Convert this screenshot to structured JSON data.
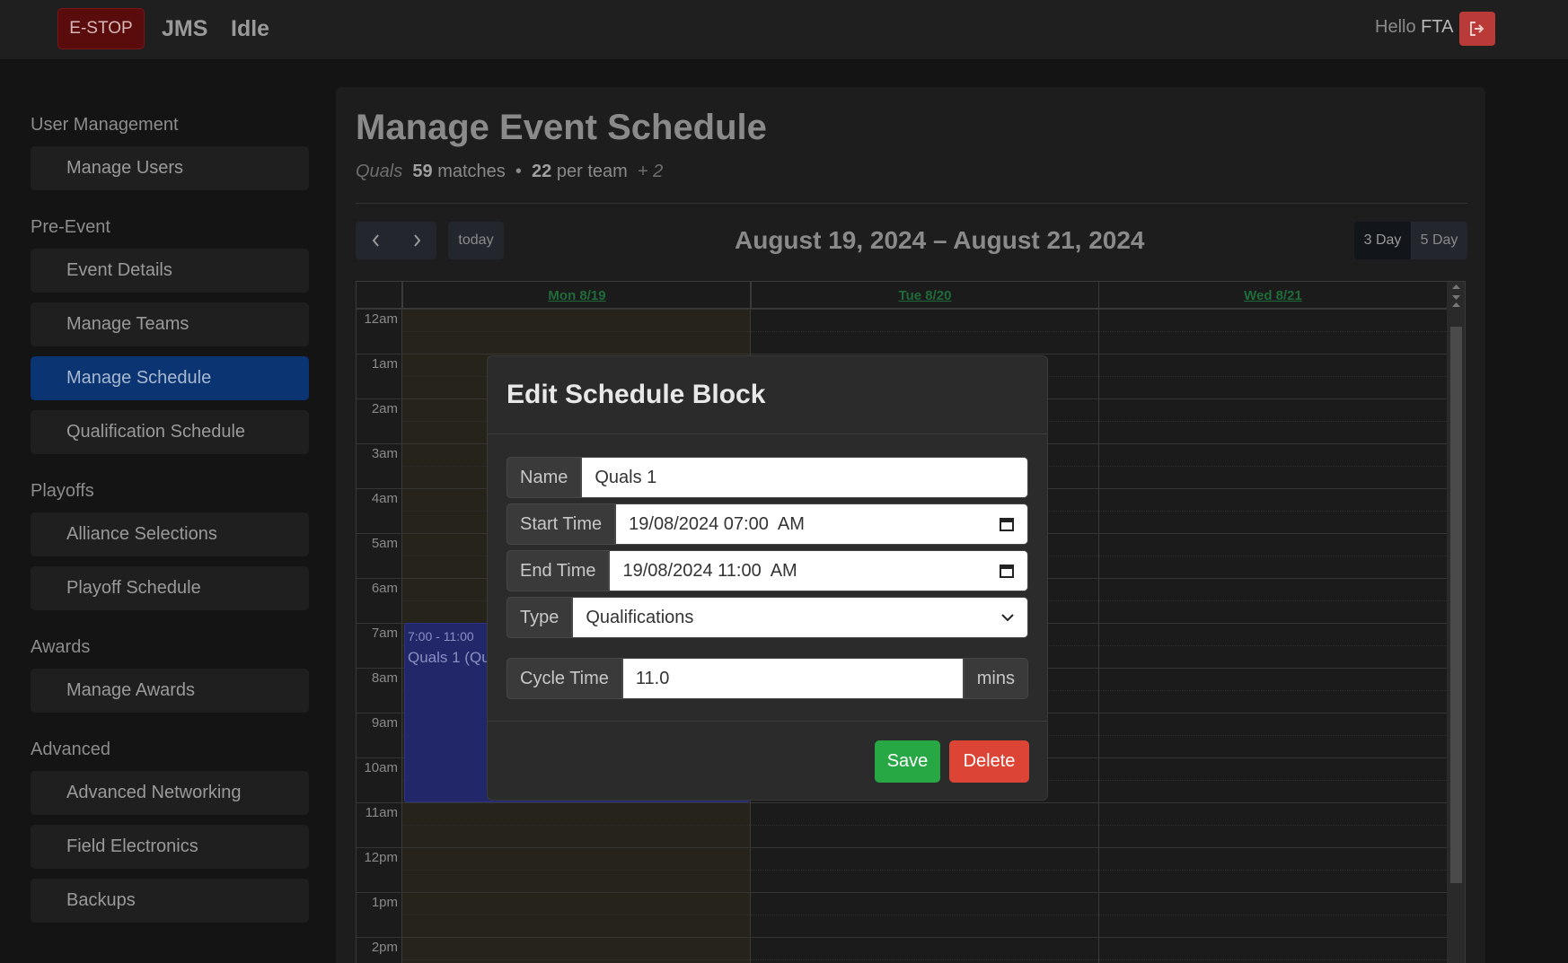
{
  "topbar": {
    "estop_label": "E-STOP",
    "brand": "JMS",
    "state": "Idle",
    "greeting": "Hello",
    "user": "FTA"
  },
  "sidebar": {
    "sections": [
      {
        "title": "User Management",
        "items": [
          "Manage Users"
        ]
      },
      {
        "title": "Pre-Event",
        "items": [
          "Event Details",
          "Manage Teams",
          "Manage Schedule",
          "Qualification Schedule"
        ]
      },
      {
        "title": "Playoffs",
        "items": [
          "Alliance Selections",
          "Playoff Schedule"
        ]
      },
      {
        "title": "Awards",
        "items": [
          "Manage Awards"
        ]
      },
      {
        "title": "Advanced",
        "items": [
          "Advanced Networking",
          "Field Electronics",
          "Backups"
        ]
      }
    ],
    "active_item": "Manage Schedule"
  },
  "page": {
    "title": "Manage Event Schedule",
    "summary_type": "Quals",
    "match_count": "59",
    "match_label": "matches",
    "bullet": "•",
    "per_team_count": "22",
    "per_team_label": "per team",
    "extra": "+ 2"
  },
  "calendar": {
    "today_label": "today",
    "range": "August 19, 2024 – August 21, 2024",
    "view_3day": "3 Day",
    "view_5day": "5 Day",
    "days": [
      "Mon 8/19",
      "Tue 8/20",
      "Wed 8/21"
    ],
    "hours": [
      "12am",
      "1am",
      "2am",
      "3am",
      "4am",
      "5am",
      "6am",
      "7am",
      "8am",
      "9am",
      "10am",
      "11am",
      "12pm",
      "1pm",
      "2pm"
    ],
    "event": {
      "time": "7:00 - 11:00",
      "name": "Quals 1 (Quals)"
    }
  },
  "modal": {
    "title": "Edit Schedule Block",
    "name_label": "Name",
    "name_value": "Quals 1",
    "start_label": "Start Time",
    "start_value": "19/08/2024 07:00  AM",
    "end_label": "End Time",
    "end_value": "19/08/2024 11:00  AM",
    "type_label": "Type",
    "type_value": "Qualifications",
    "cycle_label": "Cycle Time",
    "cycle_value": "11.0",
    "cycle_unit": "mins",
    "save_label": "Save",
    "delete_label": "Delete"
  },
  "colors": {
    "active_nav": "#0b3472",
    "estop": "#5a0c0c",
    "save": "#28a745",
    "delete": "#dc4535",
    "event_block": "#22276a"
  }
}
